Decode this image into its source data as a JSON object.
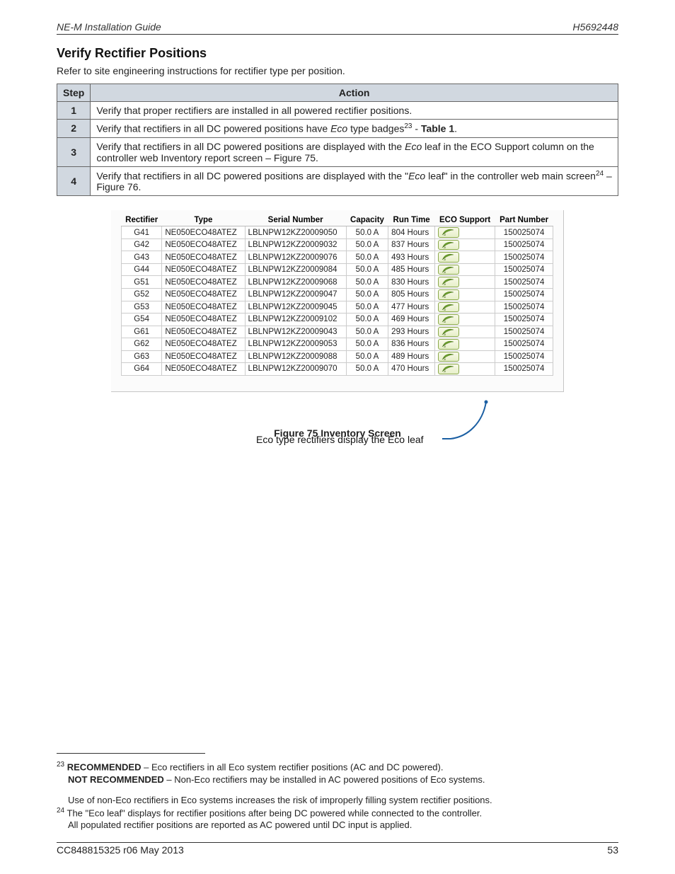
{
  "header": {
    "title_left": "NE-M Installation Guide",
    "title_right": "H5692448"
  },
  "section_title": "Verify Rectifier Positions",
  "intro_line": "Refer to site engineering instructions for rectifier type per position.",
  "step_table": {
    "head_step": "Step",
    "head_action": "Action",
    "rows": [
      {
        "n": "1",
        "pre": "Verify that proper rectifiers are installed in all powered rectifier positions.",
        "sup": "",
        "post": ""
      },
      {
        "n": "2",
        "pre": "Verify that rectifiers in all DC powered positions have Eco type badges",
        "sup": "23",
        "post": " - Table 1.",
        "italic_word": "Eco",
        "bold_post": "Table 1"
      },
      {
        "n": "3",
        "pre": "Verify that rectifiers in all DC powered positions are displayed with the Eco leaf in the ECO Support column on the controller web Inventory report screen – Figure 75.",
        "sup": "",
        "post": "",
        "italic_word": "Eco"
      },
      {
        "n": "4",
        "pre": "Verify that rectifiers in all DC powered positions are displayed with the \"Eco leaf\" in the controller web main screen",
        "sup": "24",
        "post": " – Figure 76.",
        "italic_word": "Eco"
      }
    ]
  },
  "inventory": {
    "columns": [
      "Rectifier",
      "Type",
      "Serial Number",
      "Capacity",
      "Run Time",
      "ECO Support",
      "Part Number"
    ],
    "rows": [
      {
        "rectifier": "G41",
        "type": "NE050ECO48ATEZ",
        "serial": "LBLNPW12KZ20009050",
        "capacity": "50.0 A",
        "runtime": "804 Hours",
        "part": "150025074"
      },
      {
        "rectifier": "G42",
        "type": "NE050ECO48ATEZ",
        "serial": "LBLNPW12KZ20009032",
        "capacity": "50.0 A",
        "runtime": "837 Hours",
        "part": "150025074"
      },
      {
        "rectifier": "G43",
        "type": "NE050ECO48ATEZ",
        "serial": "LBLNPW12KZ20009076",
        "capacity": "50.0 A",
        "runtime": "493 Hours",
        "part": "150025074"
      },
      {
        "rectifier": "G44",
        "type": "NE050ECO48ATEZ",
        "serial": "LBLNPW12KZ20009084",
        "capacity": "50.0 A",
        "runtime": "485 Hours",
        "part": "150025074"
      },
      {
        "rectifier": "G51",
        "type": "NE050ECO48ATEZ",
        "serial": "LBLNPW12KZ20009068",
        "capacity": "50.0 A",
        "runtime": "830 Hours",
        "part": "150025074"
      },
      {
        "rectifier": "G52",
        "type": "NE050ECO48ATEZ",
        "serial": "LBLNPW12KZ20009047",
        "capacity": "50.0 A",
        "runtime": "805 Hours",
        "part": "150025074"
      },
      {
        "rectifier": "G53",
        "type": "NE050ECO48ATEZ",
        "serial": "LBLNPW12KZ20009045",
        "capacity": "50.0 A",
        "runtime": "477 Hours",
        "part": "150025074"
      },
      {
        "rectifier": "G54",
        "type": "NE050ECO48ATEZ",
        "serial": "LBLNPW12KZ20009102",
        "capacity": "50.0 A",
        "runtime": "469 Hours",
        "part": "150025074"
      },
      {
        "rectifier": "G61",
        "type": "NE050ECO48ATEZ",
        "serial": "LBLNPW12KZ20009043",
        "capacity": "50.0 A",
        "runtime": "293 Hours",
        "part": "150025074"
      },
      {
        "rectifier": "G62",
        "type": "NE050ECO48ATEZ",
        "serial": "LBLNPW12KZ20009053",
        "capacity": "50.0 A",
        "runtime": "836 Hours",
        "part": "150025074"
      },
      {
        "rectifier": "G63",
        "type": "NE050ECO48ATEZ",
        "serial": "LBLNPW12KZ20009088",
        "capacity": "50.0 A",
        "runtime": "489 Hours",
        "part": "150025074"
      },
      {
        "rectifier": "G64",
        "type": "NE050ECO48ATEZ",
        "serial": "LBLNPW12KZ20009070",
        "capacity": "50.0 A",
        "runtime": "470 Hours",
        "part": "150025074"
      }
    ]
  },
  "callout_text": "Eco type rectifiers display the Eco leaf",
  "figure_caption": "Figure 75 Inventory Screen",
  "footnotes": {
    "fn23_a": "RECOMMENDED",
    "fn23_a_rest": " – Eco rectifiers in all Eco system rectifier positions (AC and DC powered).",
    "fn23_b": "NOT RECOMMENDED",
    "fn23_b_rest": " – Non-Eco rectifiers may be installed in AC powered positions of Eco systems.",
    "fn23_c": "Use of non-Eco rectifiers in Eco systems increases the risk of improperly filling system rectifier positions.",
    "fn24_a": "The \"Eco leaf\" displays for rectifier positions after being DC powered while connected to the controller.",
    "fn24_b": "All populated rectifier positions are reported as AC powered until DC input is applied."
  },
  "footer": {
    "left": "CC848815325  r06  May 2013",
    "right": "53"
  }
}
